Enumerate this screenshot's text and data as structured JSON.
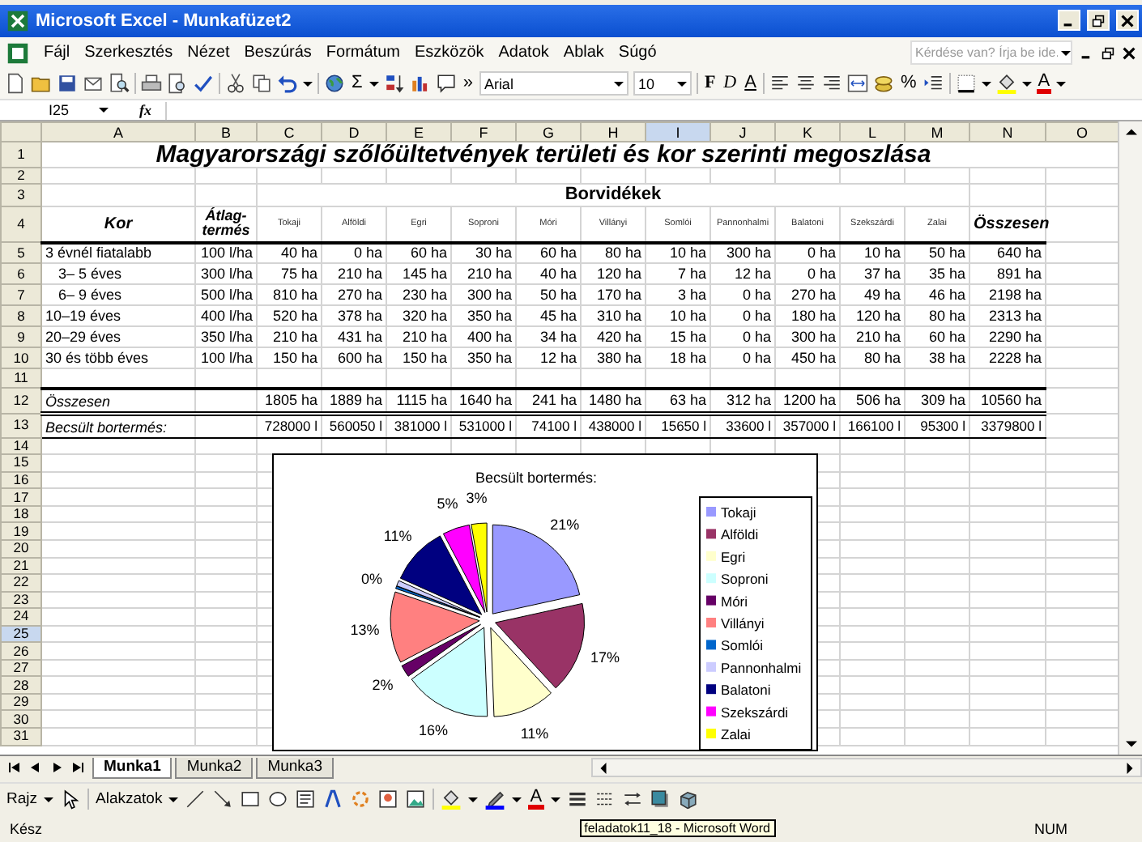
{
  "window": {
    "title": "Microsoft Excel - Munkafüzet2"
  },
  "menu": {
    "items": [
      "Fájl",
      "Szerkesztés",
      "Nézet",
      "Beszúrás",
      "Formátum",
      "Eszközök",
      "Adatok",
      "Ablak",
      "Súgó"
    ],
    "help_placeholder": "Kérdése van? Írja be ide."
  },
  "toolbar": {
    "autosum": "Σ",
    "more": "»",
    "font": "Arial",
    "size": "10",
    "bold": "F",
    "italic": "D",
    "underline": "A",
    "percent": "%",
    "font_color": "A"
  },
  "formula_bar": {
    "name_box": "I25",
    "fx": "fx"
  },
  "sheet": {
    "columns": [
      {
        "label": "A",
        "selected": false
      },
      {
        "label": "B",
        "selected": false
      },
      {
        "label": "C",
        "selected": false
      },
      {
        "label": "D",
        "selected": false
      },
      {
        "label": "E",
        "selected": false
      },
      {
        "label": "F",
        "selected": false
      },
      {
        "label": "G",
        "selected": false
      },
      {
        "label": "H",
        "selected": false
      },
      {
        "label": "I",
        "selected": true
      },
      {
        "label": "J",
        "selected": false
      },
      {
        "label": "K",
        "selected": false
      },
      {
        "label": "L",
        "selected": false
      },
      {
        "label": "M",
        "selected": false
      },
      {
        "label": "N",
        "selected": false
      },
      {
        "label": "O",
        "selected": false
      }
    ],
    "row_numbers": [
      {
        "label": "1",
        "selected": false
      },
      {
        "label": "2",
        "selected": false
      },
      {
        "label": "3",
        "selected": false
      },
      {
        "label": "4",
        "selected": false
      },
      {
        "label": "5",
        "selected": false
      },
      {
        "label": "6",
        "selected": false
      },
      {
        "label": "7",
        "selected": false
      },
      {
        "label": "8",
        "selected": false
      },
      {
        "label": "9",
        "selected": false
      },
      {
        "label": "10",
        "selected": false
      },
      {
        "label": "11",
        "selected": false
      },
      {
        "label": "12",
        "selected": false
      },
      {
        "label": "13",
        "selected": false
      },
      {
        "label": "14",
        "selected": false
      },
      {
        "label": "15",
        "selected": false
      },
      {
        "label": "16",
        "selected": false
      },
      {
        "label": "17",
        "selected": false
      },
      {
        "label": "18",
        "selected": false
      },
      {
        "label": "19",
        "selected": false
      },
      {
        "label": "20",
        "selected": false
      },
      {
        "label": "21",
        "selected": false
      },
      {
        "label": "22",
        "selected": false
      },
      {
        "label": "23",
        "selected": false
      },
      {
        "label": "24",
        "selected": false
      },
      {
        "label": "25",
        "selected": true
      },
      {
        "label": "26",
        "selected": false
      },
      {
        "label": "27",
        "selected": false
      },
      {
        "label": "28",
        "selected": false
      },
      {
        "label": "29",
        "selected": false
      },
      {
        "label": "30",
        "selected": false
      },
      {
        "label": "31",
        "selected": false
      }
    ],
    "title": "Magyarországi szőlőültetvények területi és kor szerinti megoszlása",
    "group_heading": "Borvidékek",
    "header": {
      "age": "Kor",
      "yield": "Átlag-termés",
      "regions": [
        "Tokaji",
        "Alföldi",
        "Egri",
        "Soproni",
        "Móri",
        "Villányi",
        "Somlói",
        "Pannonhalmi",
        "Balatoni",
        "Szekszárdi",
        "Zalai"
      ],
      "total": "Összesen"
    },
    "rows": [
      {
        "label": "3 évnél fiatalabb",
        "indented": false,
        "yield": "100 l/ha",
        "values": [
          "40 ha",
          "0 ha",
          "60 ha",
          "30 ha",
          "60 ha",
          "80 ha",
          "10 ha",
          "300 ha",
          "0 ha",
          "10 ha",
          "50 ha"
        ],
        "total": "640 ha"
      },
      {
        "label": "3– 5 éves",
        "indented": true,
        "yield": "300 l/ha",
        "values": [
          "75 ha",
          "210 ha",
          "145 ha",
          "210 ha",
          "40 ha",
          "120 ha",
          "7 ha",
          "12 ha",
          "0 ha",
          "37 ha",
          "35 ha"
        ],
        "total": "891 ha"
      },
      {
        "label": "6– 9 éves",
        "indented": true,
        "yield": "500 l/ha",
        "values": [
          "810 ha",
          "270 ha",
          "230 ha",
          "300 ha",
          "50 ha",
          "170 ha",
          "3 ha",
          "0 ha",
          "270 ha",
          "49 ha",
          "46 ha"
        ],
        "total": "2198 ha"
      },
      {
        "label": "10–19 éves",
        "indented": false,
        "yield": "400 l/ha",
        "values": [
          "520 ha",
          "378 ha",
          "320 ha",
          "350 ha",
          "45 ha",
          "310 ha",
          "10 ha",
          "0 ha",
          "180 ha",
          "120 ha",
          "80 ha"
        ],
        "total": "2313 ha"
      },
      {
        "label": "20–29 éves",
        "indented": false,
        "yield": "350 l/ha",
        "values": [
          "210 ha",
          "431 ha",
          "210 ha",
          "400 ha",
          "34 ha",
          "420 ha",
          "15 ha",
          "0 ha",
          "300 ha",
          "210 ha",
          "60 ha"
        ],
        "total": "2290 ha"
      },
      {
        "label": "30 és több éves",
        "indented": false,
        "yield": "100 l/ha",
        "values": [
          "150 ha",
          "600 ha",
          "150 ha",
          "350 ha",
          "12 ha",
          "380 ha",
          "18 ha",
          "0 ha",
          "450 ha",
          "80 ha",
          "38 ha"
        ],
        "total": "2228 ha"
      }
    ],
    "totals": {
      "label": "Összesen",
      "values": [
        "1805 ha",
        "1889 ha",
        "1115 ha",
        "1640 ha",
        "241 ha",
        "1480 ha",
        "63 ha",
        "312 ha",
        "1200 ha",
        "506 ha",
        "309 ha"
      ],
      "total": "10560 ha"
    },
    "estimate": {
      "label": "Becsült bortermés:",
      "values": [
        "728000 l",
        "560050 l",
        "381000 l",
        "531000 l",
        "74100 l",
        "438000 l",
        "15650 l",
        "33600 l",
        "357000 l",
        "166100 l",
        "95300 l"
      ],
      "total": "3379800 l"
    }
  },
  "chart": {
    "chart_data": {
      "type": "pie",
      "title": "Becsült bortermés:",
      "legend": "right",
      "categories": [
        "Tokaji",
        "Alföldi",
        "Egri",
        "Soproni",
        "Móri",
        "Villányi",
        "Somlói",
        "Pannonhalmi",
        "Balatoni",
        "Szekszárdi",
        "Zalai"
      ],
      "series": [
        {
          "values": [
            21.56,
            16.57,
            11.27,
            15.71,
            2.19,
            12.96,
            0.46,
            0.99,
            10.56,
            4.91,
            2.82
          ]
        }
      ],
      "value_labels": [
        "21%",
        "17%",
        "11%",
        "16%",
        "2%",
        "13%",
        "0%",
        null,
        "11%",
        "5%",
        "3%"
      ]
    },
    "slices": [
      {
        "color": "#9999ff"
      },
      {
        "color": "#993366"
      },
      {
        "color": "#ffffcc"
      },
      {
        "color": "#ccffff"
      },
      {
        "color": "#660066"
      },
      {
        "color": "#ff8080"
      },
      {
        "color": "#0066cc"
      },
      {
        "color": "#ccccff"
      },
      {
        "color": "#000080"
      },
      {
        "color": "#ff00ff"
      },
      {
        "color": "#ffff00"
      }
    ]
  },
  "sheet_tabs": [
    {
      "label": "Munka1",
      "selected": true
    },
    {
      "label": "Munka2",
      "selected": false
    },
    {
      "label": "Munka3",
      "selected": false
    }
  ],
  "drawing_toolbar": {
    "draw": "Rajz",
    "shapes": "Alakzatok",
    "font_color": "A"
  },
  "status_bar": {
    "status": "Kész",
    "task_tooltip": "feladatok11_18 - Microsoft Word",
    "num": "NUM"
  }
}
